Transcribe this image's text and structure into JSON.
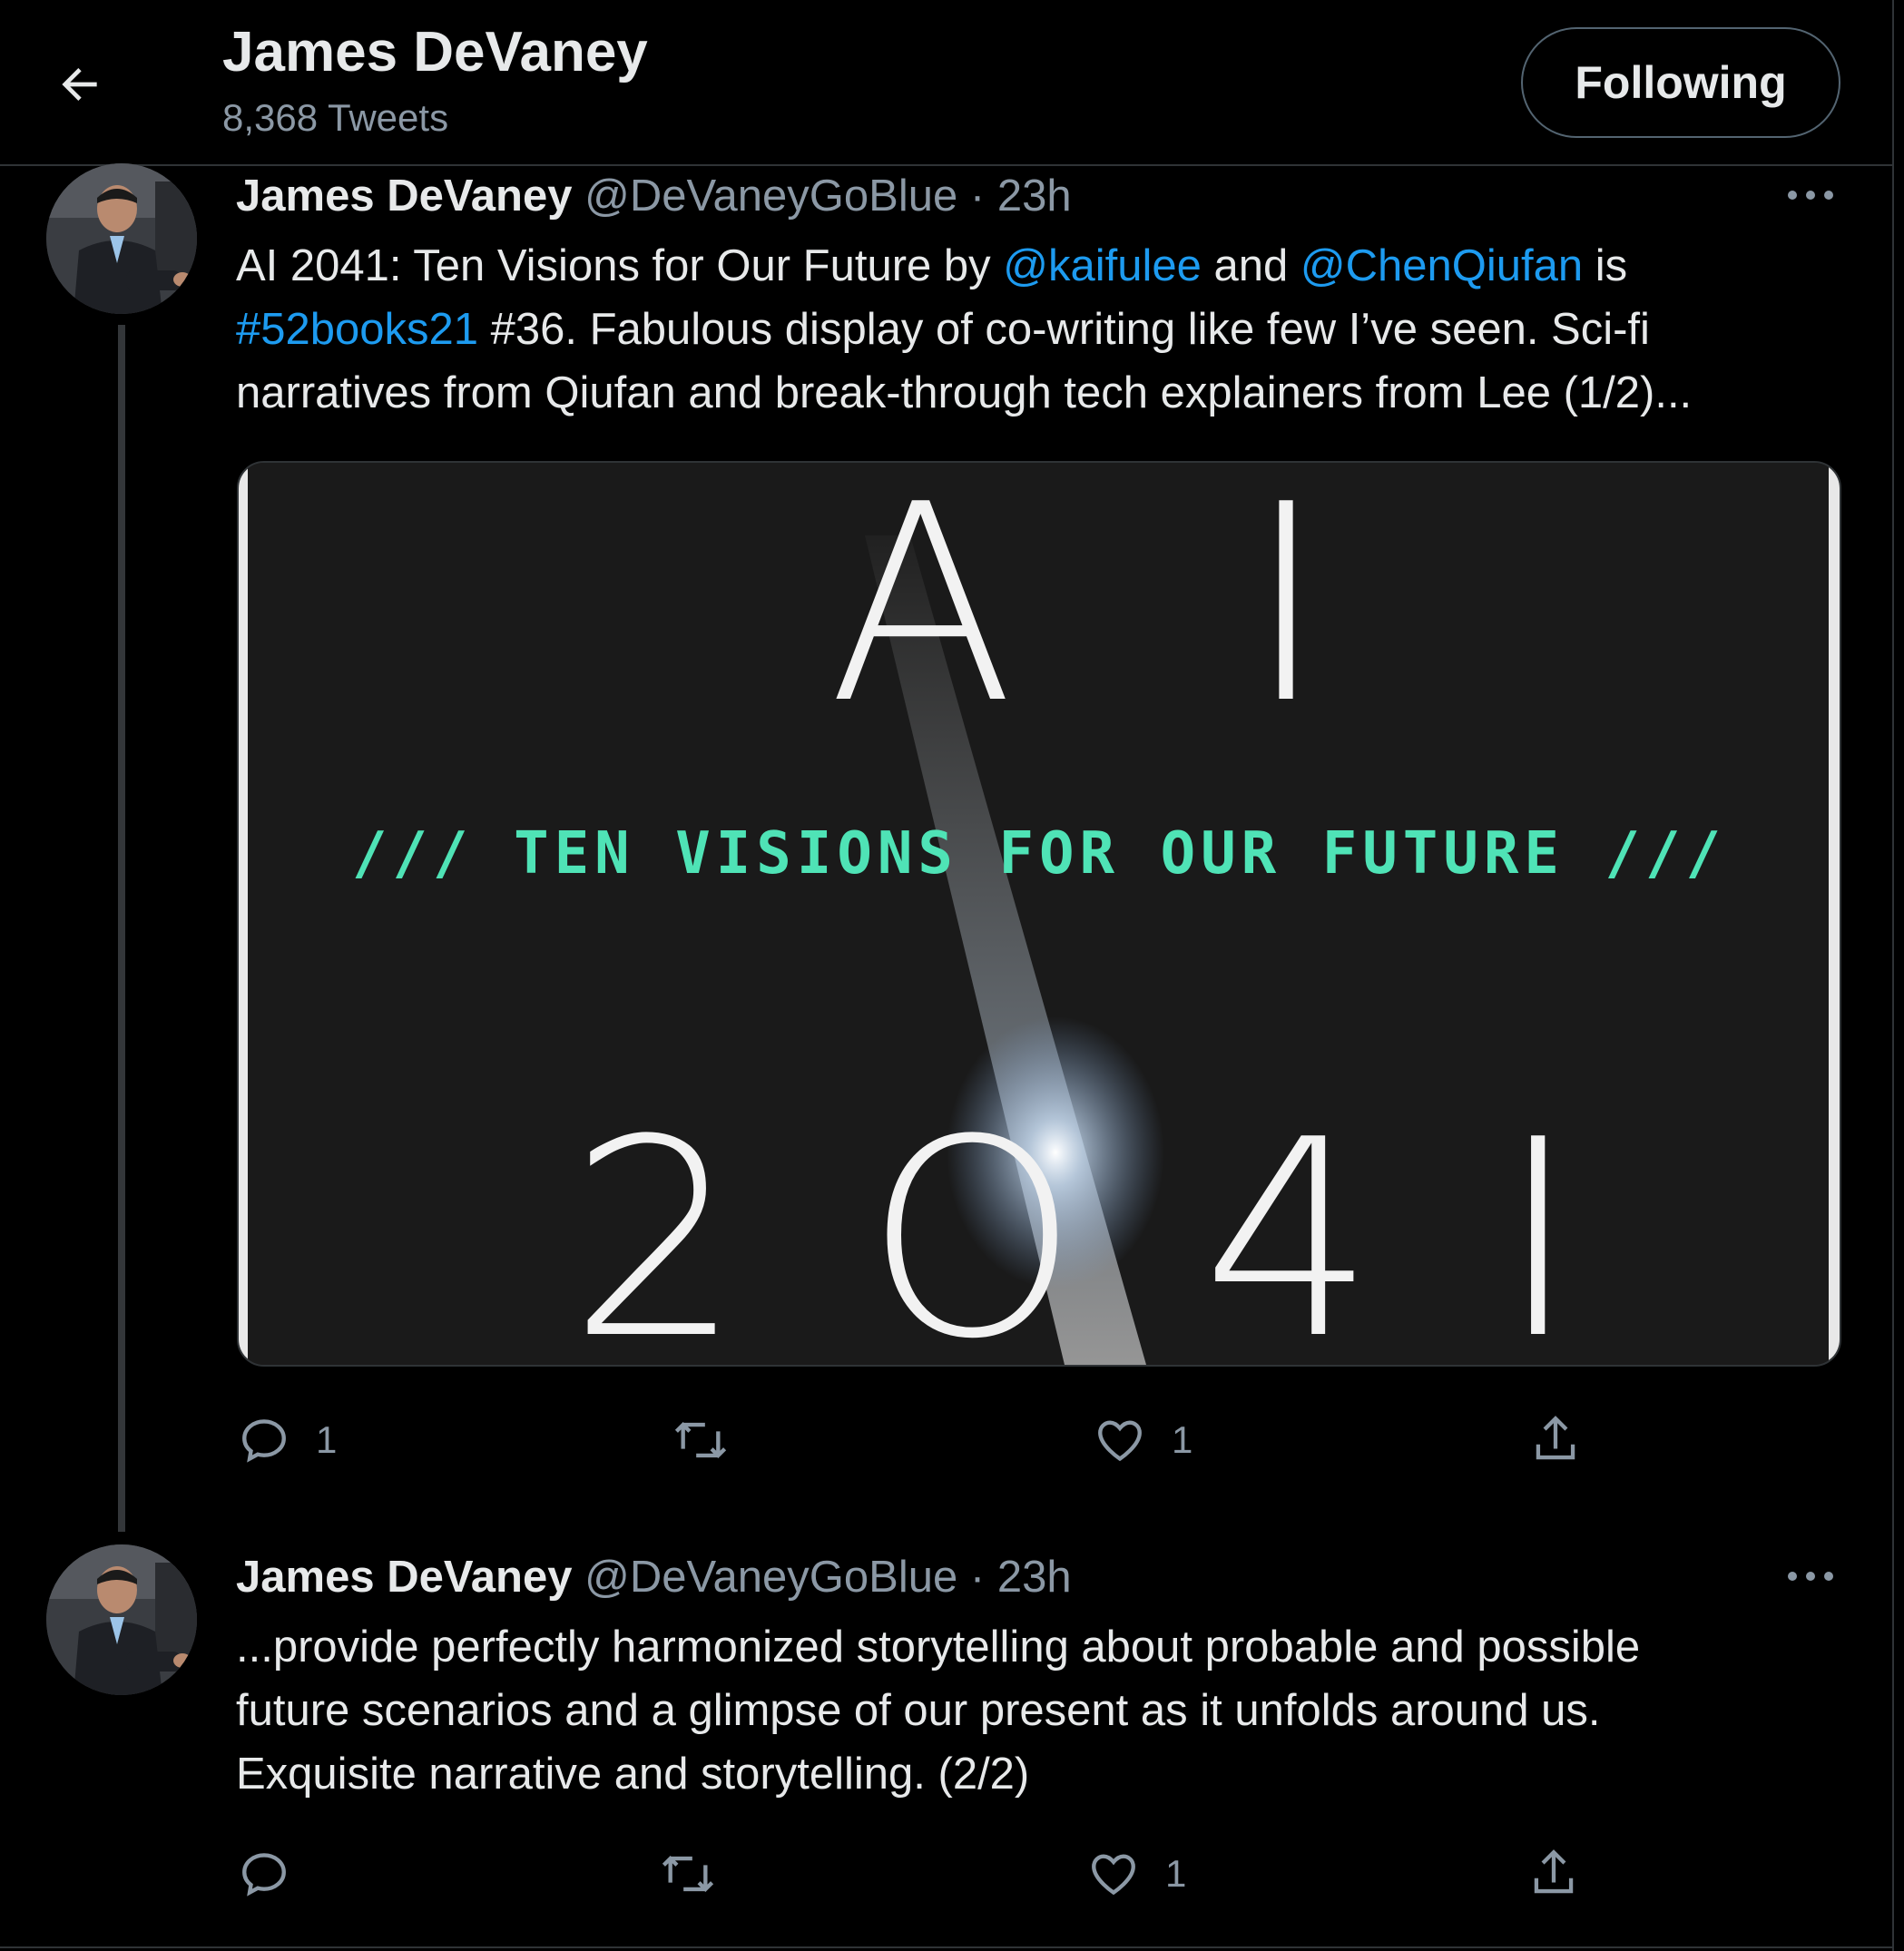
{
  "header": {
    "title": "James DeVaney",
    "tweet_count": "8,368 Tweets",
    "follow_label": "Following",
    "back_icon": "arrow-left-icon"
  },
  "tweets": [
    {
      "name": "James DeVaney",
      "handle": "@DeVaneyGoBlue",
      "separator": "·",
      "time": "23h",
      "text": {
        "line1_a": "AI 2041: Ten Visions for Our Future by ",
        "mention1": "@kaifulee",
        "line1_b": " and ",
        "mention2": "@ChenQiufan",
        "line1_c": " is",
        "hashtag": "#52books21",
        "line2_b": " #36. Fabulous display of co-writing like few I’ve seen. Sci-fi",
        "line3": "narratives from Qiufan and break-through tech explainers from Lee (1/2)..."
      },
      "media": {
        "top_text": "A I",
        "subtitle": "/// TEN VISIONS FOR OUR FUTURE ///",
        "bottom_text": "2 O 4 I"
      },
      "actions": {
        "reply": "1",
        "retweet": "",
        "like": "1"
      }
    },
    {
      "name": "James DeVaney",
      "handle": "@DeVaneyGoBlue",
      "separator": "·",
      "time": "23h",
      "text": {
        "line1": "...provide perfectly harmonized storytelling about probable and possible",
        "line2": "future scenarios and a glimpse of our present as it unfolds around us.",
        "line3": "Exquisite narrative and storytelling. (2/2)"
      },
      "actions": {
        "reply": "",
        "retweet": "",
        "like": "1"
      }
    }
  ],
  "colors": {
    "link": "#1d9bf0",
    "muted": "#8b98a5",
    "text": "#e7e9ea",
    "background": "#000000",
    "cover_accent": "#4fe3b6"
  }
}
